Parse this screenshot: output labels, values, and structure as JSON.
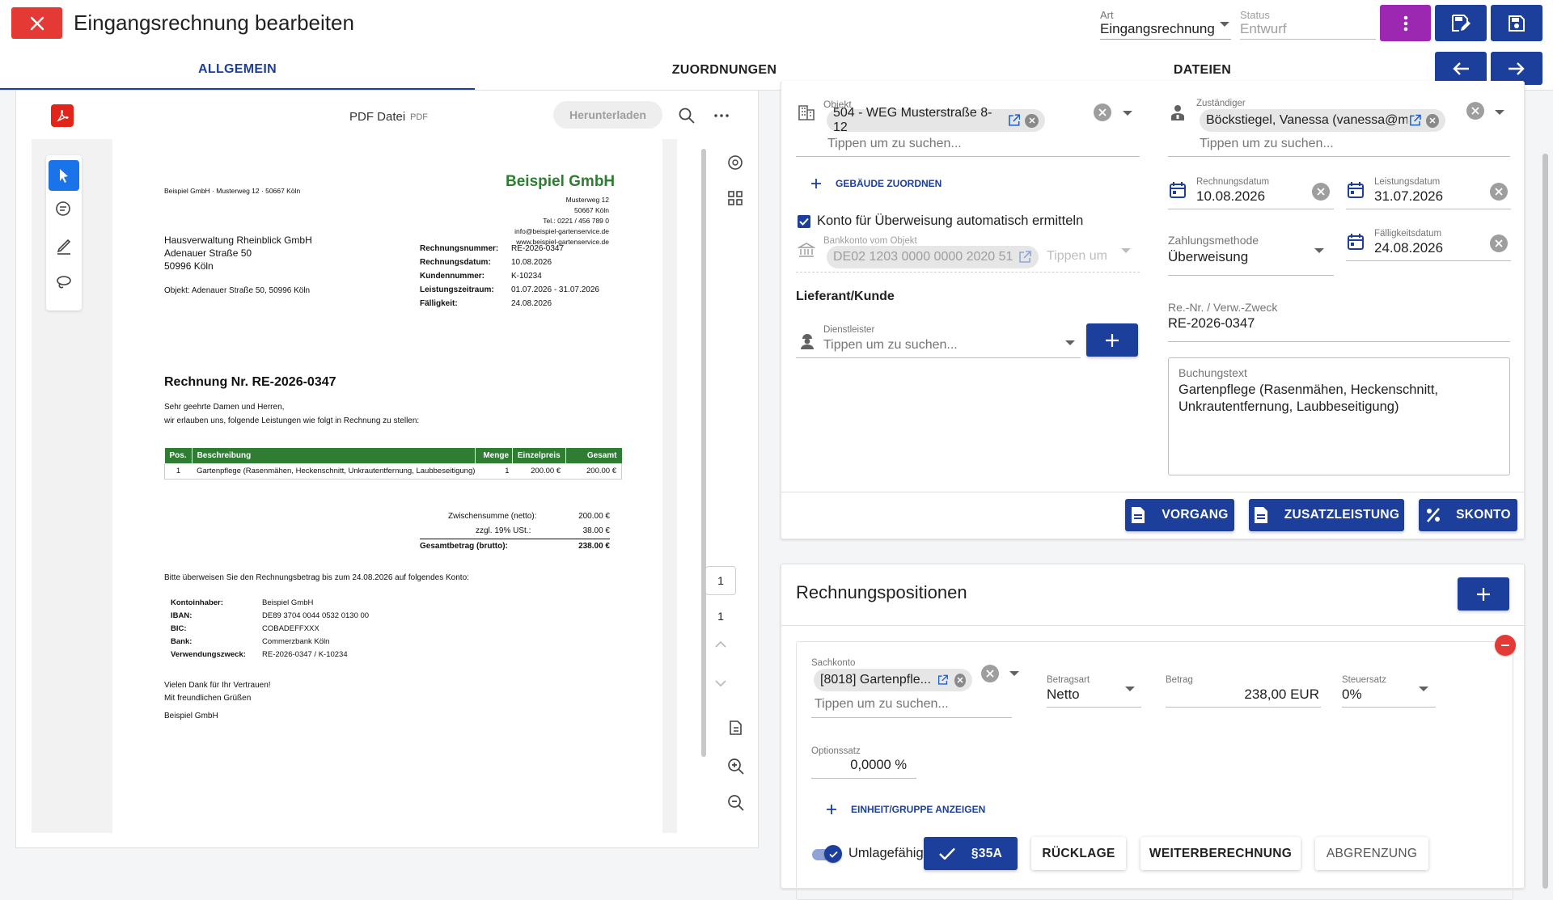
{
  "header": {
    "title": "Eingangsrechnung bearbeiten",
    "art_label": "Art",
    "art_value": "Eingangsrechnung",
    "status_label": "Status",
    "status_placeholder": "Entwurf"
  },
  "tabs": [
    {
      "label": "ALLGEMEIN",
      "active": true
    },
    {
      "label": "ZUORDNUNGEN",
      "active": false
    },
    {
      "label": "DATEIEN",
      "active": false
    }
  ],
  "colors": {
    "primary": "#1b3f9a",
    "danger": "#e53935",
    "purple": "#9c27b0",
    "green": "#2e7d32"
  },
  "pdf": {
    "file_title": "PDF Datei",
    "file_ext": "PDF",
    "download_label": "Herunterladen",
    "page_current": "1",
    "page_total": "1",
    "doc": {
      "sender_line": "Beispiel GmbH · Musterweg 12 · 50667 Köln",
      "company": "Beispiel GmbH",
      "company_addr": [
        "Musterweg 12",
        "50667 Köln",
        "Tel.: 0221 / 456 789 0",
        "info@beispiel-gartenservice.de",
        "www.beispiel-gartenservice.de"
      ],
      "recipient": [
        "Hausverwaltung Rheinblick GmbH",
        "Adenauer Straße 50",
        "50996 Köln"
      ],
      "objekt_line": "Objekt: Adenauer Straße 50, 50996 Köln",
      "meta": [
        {
          "k": "Rechnungsnummer:",
          "v": "RE-2026-0347"
        },
        {
          "k": "Rechnungsdatum:",
          "v": "10.08.2026"
        },
        {
          "k": "Kundennummer:",
          "v": "K-10234"
        },
        {
          "k": "Leistungszeitraum:",
          "v": "01.07.2026 - 31.07.2026"
        },
        {
          "k": "Fälligkeit:",
          "v": "24.08.2026"
        }
      ],
      "heading": "Rechnung Nr. RE-2026-0347",
      "intro": [
        "Sehr geehrte Damen und Herren,",
        "wir erlauben uns, folgende Leistungen wie folgt in Rechnung zu stellen:"
      ],
      "table_headers": [
        "Pos.",
        "Beschreibung",
        "Menge",
        "Einzelpreis",
        "Gesamt"
      ],
      "table_row": [
        "1",
        "Gartenpflege (Rasenmähen, Heckenschnitt, Unkrautentfernung, Laubbeseitigung)",
        "1",
        "200.00 €",
        "200.00 €"
      ],
      "sums": [
        {
          "k": "Zwischensumme (netto):",
          "v": "200.00 €"
        },
        {
          "k": "zzgl. 19% USt.:",
          "v": "38.00 €"
        },
        {
          "k": "Gesamtbetrag (brutto):",
          "v": "238.00 €"
        }
      ],
      "pay_text": "Bitte überweisen Sie den Rechnungsbetrag bis zum 24.08.2026 auf folgendes Konto:",
      "bank": [
        {
          "k": "Kontoinhaber:",
          "v": "Beispiel GmbH"
        },
        {
          "k": "IBAN:",
          "v": "DE89 3704 0044 0532 0130 00"
        },
        {
          "k": "BIC:",
          "v": "COBADEFFXXX"
        },
        {
          "k": "Bank:",
          "v": "Commerzbank Köln"
        },
        {
          "k": "Verwendungszweck:",
          "v": "RE-2026-0347 / K-10234"
        }
      ],
      "closing": [
        "Vielen Dank für Ihr Vertrauen!",
        "Mit freundlichen Grüßen",
        "Beispiel GmbH"
      ]
    }
  },
  "form": {
    "objekt_label": "Objekt",
    "objekt_chip": "504 - WEG Musterstraße 8-12",
    "search_placeholder": "Tippen um zu suchen...",
    "gebaeude_link": "GEBÄUDE ZUORDNEN",
    "konto_checkbox_label": "Konto für Überweisung automatisch ermitteln",
    "bankkonto_label": "Bankkonto vom Objekt",
    "bankkonto_chip": "DE02 1203 0000 0000 2020 51",
    "bankkonto_placeholder": "Tippen um",
    "lieferant_heading": "Lieferant/Kunde",
    "dienstleister_label": "Dienstleister",
    "zustaendiger_label": "Zuständiger",
    "zustaendiger_chip": "Böckstiegel, Vanessa (vanessa@m...",
    "rechnungsdatum_label": "Rechnungsdatum",
    "rechnungsdatum": "10.08.2026",
    "leistungsdatum_label": "Leistungsdatum",
    "leistungsdatum": "31.07.2026",
    "zahlungsmethode_label": "Zahlungsmethode",
    "zahlungsmethode": "Überweisung",
    "faelligkeitsdatum_label": "Fälligkeitsdatum",
    "faelligkeitsdatum": "24.08.2026",
    "renr_label": "Re.-Nr. / Verw.-Zweck",
    "renr": "RE-2026-0347",
    "buchungstext_label": "Buchungstext",
    "buchungstext": "Gartenpflege (Rasenmähen, Heckenschnitt, Unkrautentfernung, Laubbeseitigung)",
    "btn_vorgang": "VORGANG",
    "btn_zusatz": "ZUSATZLEISTUNG",
    "btn_skonto": "SKONTO"
  },
  "positions": {
    "heading": "Rechnungspositionen",
    "sachkonto_label": "Sachkonto",
    "sachkonto_chip": "[8018] Gartenpfle...",
    "betragsart_label": "Betragsart",
    "betragsart": "Netto",
    "betrag_label": "Betrag",
    "betrag": "238,00 EUR",
    "steuersatz_label": "Steuersatz",
    "steuersatz": "0%",
    "optionssatz_label": "Optionssatz",
    "optionssatz": "0,0000 %",
    "einheit_link": "EINHEIT/GRUPPE ANZEIGEN",
    "umlage_label": "Umlagefähig",
    "btn_35a": "§35A",
    "btn_ruecklage": "RÜCKLAGE",
    "btn_weiter": "WEITERBERECHNUNG",
    "btn_abgrenzung": "ABGRENZUNG"
  }
}
